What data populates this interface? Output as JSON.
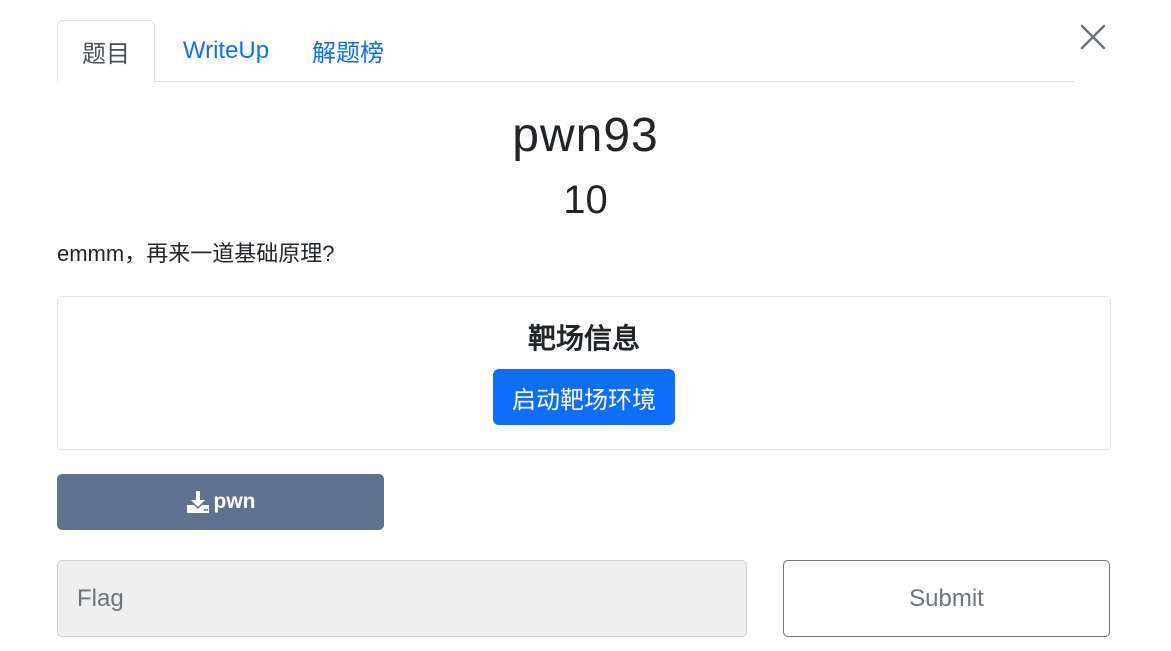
{
  "tabs": [
    {
      "label": "题目",
      "active": true
    },
    {
      "label": "WriteUp",
      "active": false
    },
    {
      "label": "解题榜",
      "active": false
    }
  ],
  "challenge": {
    "name": "pwn93",
    "points": "10",
    "description": "emmm，再来一道基础原理?"
  },
  "range": {
    "title": "靶场信息",
    "start_label": "启动靶场环境"
  },
  "download": {
    "icon": "download-icon",
    "label": "pwn"
  },
  "flag_form": {
    "placeholder": "Flag",
    "value": "",
    "submit_label": "Submit"
  },
  "icons": {
    "close": "close-icon"
  },
  "colors": {
    "primary": "#0d6efd",
    "download_button": "#5f728f",
    "input_background": "#efefef"
  }
}
